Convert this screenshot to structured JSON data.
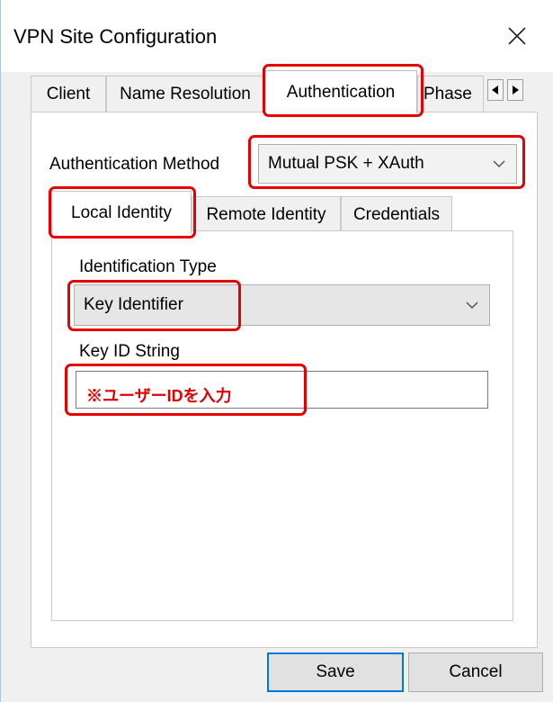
{
  "window": {
    "title": "VPN Site Configuration"
  },
  "tabs": [
    {
      "label": "Client"
    },
    {
      "label": "Name Resolution"
    },
    {
      "label": "Authentication"
    },
    {
      "label": "Phase"
    }
  ],
  "authentication": {
    "method_label": "Authentication Method",
    "method_value": "Mutual PSK + XAuth"
  },
  "inner_tabs": [
    {
      "label": "Local Identity"
    },
    {
      "label": "Remote Identity"
    },
    {
      "label": "Credentials"
    }
  ],
  "local_identity": {
    "identification_type_label": "Identification Type",
    "identification_type_value": "Key Identifier",
    "key_id_label": "Key ID String",
    "key_id_value": "※ユーザーIDを入力"
  },
  "buttons": {
    "save": "Save",
    "cancel": "Cancel"
  },
  "annotations": {
    "highlight_color": "#e60000"
  }
}
